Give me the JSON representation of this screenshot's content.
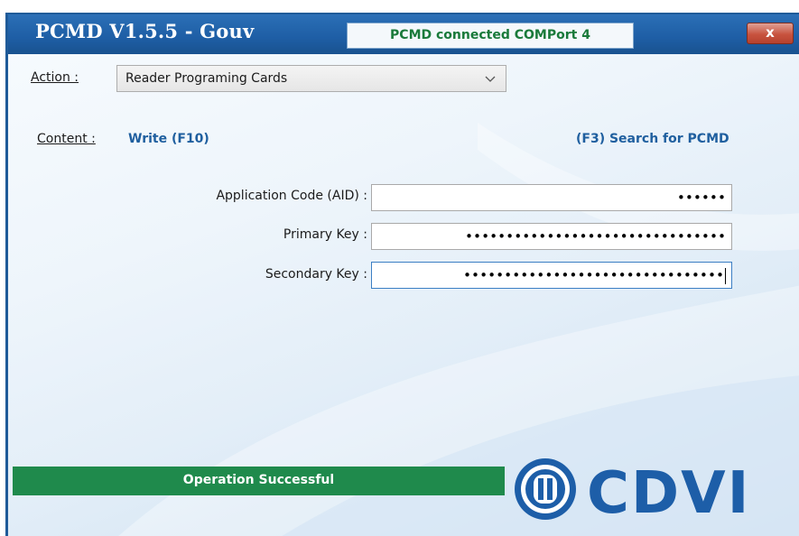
{
  "window": {
    "title": "PCMD  V1.5.5 - Gouv",
    "connection_status": "PCMD connected COMPort 4",
    "close_glyph": "x"
  },
  "action": {
    "label": "Action :",
    "selected": "Reader Programing Cards"
  },
  "content": {
    "label": "Content :",
    "mode": "Write (F10)",
    "search": "(F3) Search for PCMD"
  },
  "fields": [
    {
      "label": "Application Code (AID) :",
      "value": "••••••"
    },
    {
      "label": "Primary Key :",
      "value": "••••••••••••••••••••••••••••••••"
    },
    {
      "label": "Secondary Key :",
      "value": "••••••••••••••••••••••••••••••••"
    }
  ],
  "status": {
    "message": "Operation Successful"
  },
  "logo": {
    "text": "CDVI"
  },
  "colors": {
    "title_bar": "#1e5ea5",
    "status_text": "#1a7a3a",
    "accent_text": "#1f5f9f",
    "success_bar": "#1f8a4c",
    "logo": "#1d5ea8"
  },
  "icons": [
    "chevron-down-icon",
    "close-icon",
    "cdvi-logo"
  ]
}
